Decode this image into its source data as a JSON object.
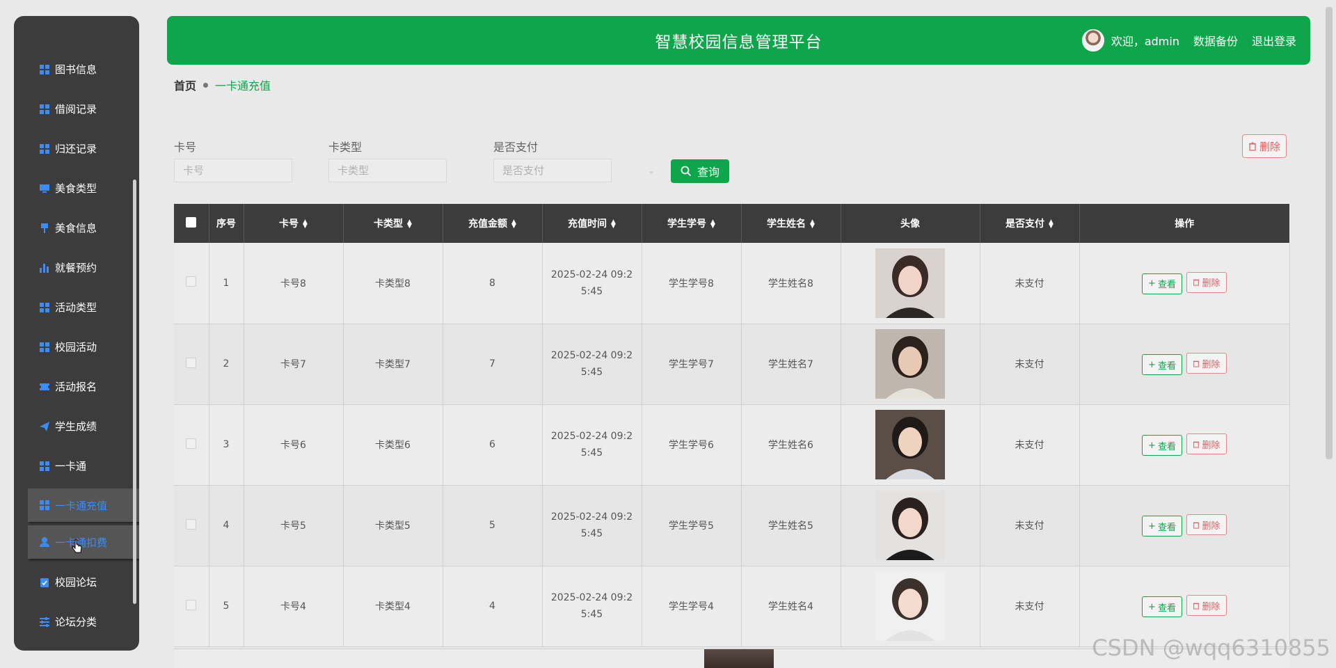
{
  "header": {
    "title": "智慧校园信息管理平台",
    "welcome": "欢迎，admin",
    "backup": "数据备份",
    "logout": "退出登录"
  },
  "sidebar": {
    "items": [
      {
        "label": "图书信息",
        "icon": "grid-icon"
      },
      {
        "label": "借阅记录",
        "icon": "grid-icon"
      },
      {
        "label": "归还记录",
        "icon": "grid-icon"
      },
      {
        "label": "美食类型",
        "icon": "monitor-icon"
      },
      {
        "label": "美食信息",
        "icon": "pin-icon"
      },
      {
        "label": "就餐预约",
        "icon": "bar-chart-icon"
      },
      {
        "label": "活动类型",
        "icon": "grid-icon"
      },
      {
        "label": "校园活动",
        "icon": "grid-icon"
      },
      {
        "label": "活动报名",
        "icon": "ticket-icon"
      },
      {
        "label": "学生成绩",
        "icon": "send-icon"
      },
      {
        "label": "一卡通",
        "icon": "grid-icon"
      },
      {
        "label": "一卡通充值",
        "icon": "grid-icon"
      },
      {
        "label": "一卡通扣费",
        "icon": "user-icon"
      },
      {
        "label": "校园论坛",
        "icon": "clipboard-icon"
      },
      {
        "label": "论坛分类",
        "icon": "sliders-icon"
      }
    ]
  },
  "breadcrumb": {
    "home": "首页",
    "current": "一卡通充值"
  },
  "filters": {
    "card_no": {
      "label": "卡号",
      "placeholder": "卡号"
    },
    "card_type": {
      "label": "卡类型",
      "placeholder": "卡类型"
    },
    "paid": {
      "label": "是否支付",
      "placeholder": "是否支付"
    },
    "query_button": "查询",
    "delete_button": "删除"
  },
  "table": {
    "columns": [
      "序号",
      "卡号",
      "卡类型",
      "充值金额",
      "充值时间",
      "学生学号",
      "学生姓名",
      "头像",
      "是否支付",
      "操作"
    ],
    "rows": [
      {
        "index": "1",
        "card_no": "卡号8",
        "card_type": "卡类型8",
        "amount": "8",
        "time": "2025-02-24 09:25:45",
        "student_no": "学生学号8",
        "student_name": "学生姓名8",
        "paid": "未支付"
      },
      {
        "index": "2",
        "card_no": "卡号7",
        "card_type": "卡类型7",
        "amount": "7",
        "time": "2025-02-24 09:25:45",
        "student_no": "学生学号7",
        "student_name": "学生姓名7",
        "paid": "未支付"
      },
      {
        "index": "3",
        "card_no": "卡号6",
        "card_type": "卡类型6",
        "amount": "6",
        "time": "2025-02-24 09:25:45",
        "student_no": "学生学号6",
        "student_name": "学生姓名6",
        "paid": "未支付"
      },
      {
        "index": "4",
        "card_no": "卡号5",
        "card_type": "卡类型5",
        "amount": "5",
        "time": "2025-02-24 09:25:45",
        "student_no": "学生学号5",
        "student_name": "学生姓名5",
        "paid": "未支付"
      },
      {
        "index": "5",
        "card_no": "卡号4",
        "card_type": "卡类型4",
        "amount": "4",
        "time": "2025-02-24 09:25:45",
        "student_no": "学生学号4",
        "student_name": "学生姓名4",
        "paid": "未支付"
      }
    ],
    "view_label": "查看",
    "delete_label": "删除"
  },
  "colors": {
    "brand_green": "#0fa54a",
    "sidebar_bg": "#3c3c3c",
    "active_blue": "#3d8bf5",
    "danger": "#e06060"
  },
  "watermark": "CSDN @wqq6310855"
}
